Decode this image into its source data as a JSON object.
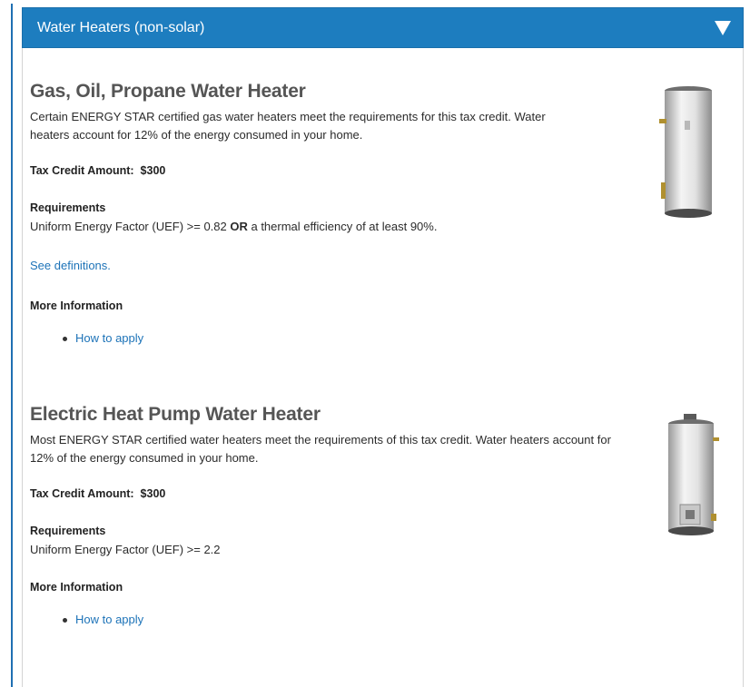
{
  "accordion": {
    "title": "Water Heaters (non-solar)",
    "toggle_icon": "triangle-down-icon"
  },
  "sections": [
    {
      "title": "Gas, Oil, Propane Water Heater",
      "description": "Certain ENERGY STAR certified gas water heaters meet the requirements for this tax credit. Water heaters account for 12% of the energy consumed in your home.",
      "description_line1": "Certain ENERGY STAR certified gas water heaters meet the requirements for this tax credit. Water",
      "description_line2": "heaters account for 12% of the energy consumed in your home.",
      "tax_credit_label": "Tax Credit Amount:",
      "tax_credit_value": "$300",
      "requirements_label": "Requirements",
      "requirements_pre": "Uniform Energy Factor (UEF) >= 0.82 ",
      "requirements_bold": "OR",
      "requirements_post": " a thermal efficiency of at least 90%.",
      "definitions_link": "See definitions.",
      "more_info_label": "More Information",
      "more_info_link": "How to apply",
      "image": "gas-water-heater-image"
    },
    {
      "title": "Electric Heat Pump Water Heater",
      "description_line1": "Most ENERGY STAR certified water heaters meet the requirements of this tax credit. Water heaters account for",
      "description_line2": "12% of the energy consumed in your home.",
      "tax_credit_label": "Tax Credit Amount:",
      "tax_credit_value": "$300",
      "requirements_label": "Requirements",
      "requirements_text": "Uniform Energy Factor (UEF) >= 2.2",
      "more_info_label": "More Information",
      "more_info_link": "How to apply",
      "image": "heat-pump-water-heater-image"
    }
  ],
  "colors": {
    "header_bg": "#1d7dbf",
    "link": "#1d73b8",
    "title": "#555555"
  }
}
